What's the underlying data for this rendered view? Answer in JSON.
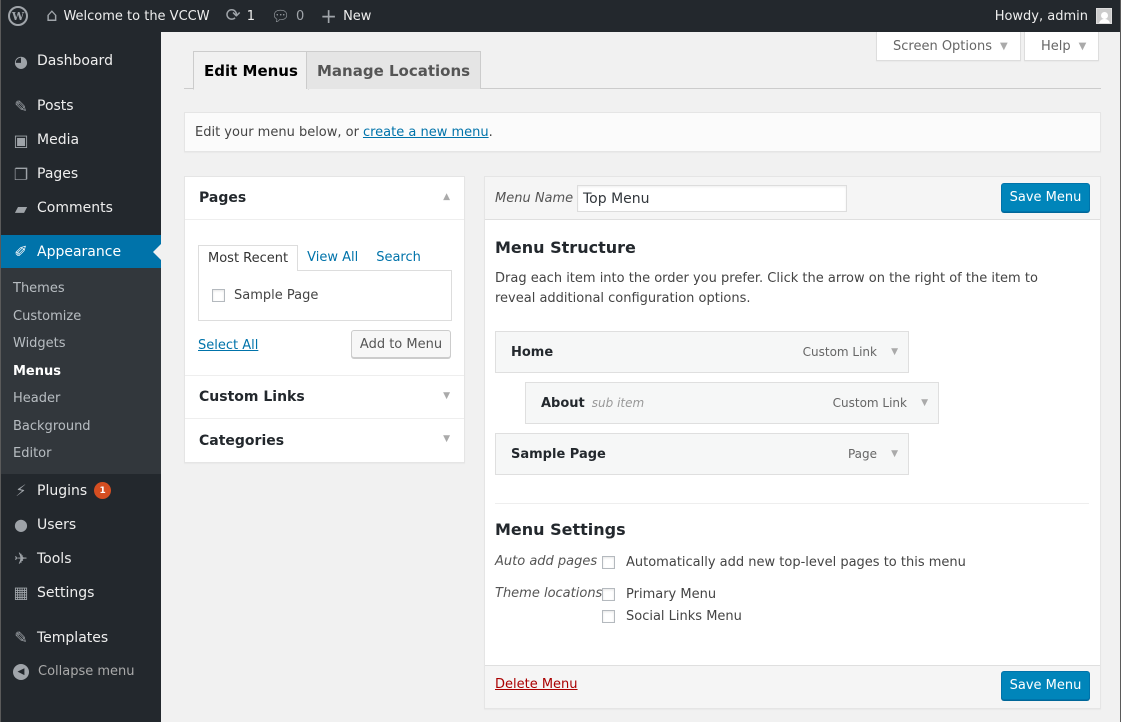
{
  "adminbar": {
    "site_name": "Welcome to the VCCW",
    "updates_count": "1",
    "comments_count": "0",
    "new_label": "New",
    "howdy": "Howdy, admin"
  },
  "sidebar": {
    "items": [
      {
        "label": "Dashboard"
      },
      {
        "label": "Posts"
      },
      {
        "label": "Media"
      },
      {
        "label": "Pages"
      },
      {
        "label": "Comments"
      },
      {
        "label": "Appearance"
      },
      {
        "label": "Plugins",
        "badge": "1"
      },
      {
        "label": "Users"
      },
      {
        "label": "Tools"
      },
      {
        "label": "Settings"
      },
      {
        "label": "Templates"
      }
    ],
    "submenu": [
      "Themes",
      "Customize",
      "Widgets",
      "Menus",
      "Header",
      "Background",
      "Editor"
    ],
    "collapse_label": "Collapse menu"
  },
  "screen_options": "Screen Options",
  "help": "Help",
  "tabs": {
    "edit": "Edit Menus",
    "locations": "Manage Locations"
  },
  "notice": {
    "text": "Edit your menu below, or ",
    "link": "create a new menu",
    "end": "."
  },
  "pages_box": {
    "title": "Pages",
    "tabs": [
      "Most Recent",
      "View All",
      "Search"
    ],
    "items": [
      "Sample Page"
    ],
    "select_all": "Select All",
    "add_button": "Add to Menu"
  },
  "custom_links": "Custom Links",
  "categories": "Categories",
  "menu": {
    "name_label": "Menu Name",
    "name_value": "Top Menu",
    "save_label": "Save Menu",
    "structure_title": "Menu Structure",
    "structure_desc": "Drag each item into the order you prefer. Click the arrow on the right of the item to reveal additional configuration options.",
    "items": [
      {
        "title": "Home",
        "type": "Custom Link"
      },
      {
        "title": "About",
        "sub": "sub item",
        "type": "Custom Link"
      },
      {
        "title": "Sample Page",
        "type": "Page"
      }
    ],
    "settings_title": "Menu Settings",
    "auto_add_label": "Auto add pages",
    "auto_add_text": "Automatically add new top-level pages to this menu",
    "theme_locations_label": "Theme locations",
    "locations": [
      "Primary Menu",
      "Social Links Menu"
    ],
    "delete_label": "Delete Menu"
  },
  "colors": {
    "accent": "#0073aa",
    "sidebar": "#23282d",
    "primary_button": "#0085ba",
    "badge": "#d54e21",
    "delete": "#a00"
  }
}
